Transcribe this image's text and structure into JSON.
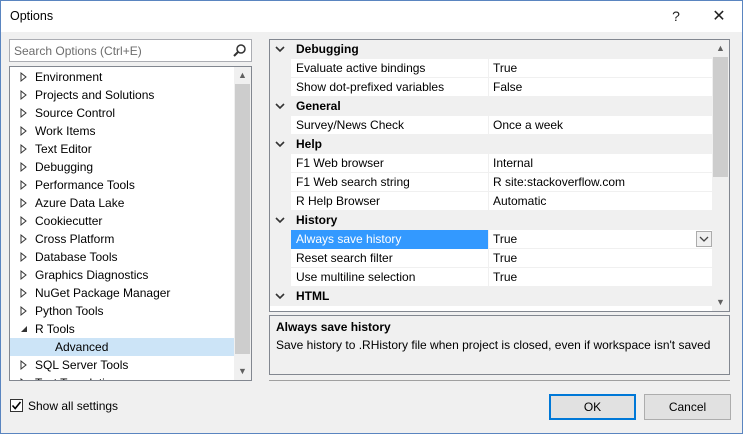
{
  "window": {
    "title": "Options",
    "help_label": "?",
    "close_label": "✕"
  },
  "search": {
    "placeholder": "Search Options (Ctrl+E)"
  },
  "tree": {
    "items": [
      {
        "label": "Environment",
        "expanded": false
      },
      {
        "label": "Projects and Solutions",
        "expanded": false
      },
      {
        "label": "Source Control",
        "expanded": false
      },
      {
        "label": "Work Items",
        "expanded": false
      },
      {
        "label": "Text Editor",
        "expanded": false
      },
      {
        "label": "Debugging",
        "expanded": false
      },
      {
        "label": "Performance Tools",
        "expanded": false
      },
      {
        "label": "Azure Data Lake",
        "expanded": false
      },
      {
        "label": "Cookiecutter",
        "expanded": false
      },
      {
        "label": "Cross Platform",
        "expanded": false
      },
      {
        "label": "Database Tools",
        "expanded": false
      },
      {
        "label": "Graphics Diagnostics",
        "expanded": false
      },
      {
        "label": "NuGet Package Manager",
        "expanded": false
      },
      {
        "label": "Python Tools",
        "expanded": false
      },
      {
        "label": "R Tools",
        "expanded": true
      },
      {
        "label": "Advanced",
        "child": true,
        "selected": true
      },
      {
        "label": "SQL Server Tools",
        "expanded": false
      },
      {
        "label": "Text Templating",
        "expanded": false
      }
    ]
  },
  "grid": {
    "categories": [
      {
        "name": "Debugging",
        "props": [
          {
            "name": "Evaluate active bindings",
            "value": "True"
          },
          {
            "name": "Show dot-prefixed variables",
            "value": "False"
          }
        ]
      },
      {
        "name": "General",
        "props": [
          {
            "name": "Survey/News Check",
            "value": "Once a week"
          }
        ]
      },
      {
        "name": "Help",
        "props": [
          {
            "name": "F1 Web browser",
            "value": "Internal"
          },
          {
            "name": "F1 Web search string",
            "value": "R site:stackoverflow.com"
          },
          {
            "name": "R Help Browser",
            "value": "Automatic"
          }
        ]
      },
      {
        "name": "History",
        "props": [
          {
            "name": "Always save history",
            "value": "True",
            "selected": true
          },
          {
            "name": "Reset search filter",
            "value": "True"
          },
          {
            "name": "Use multiline selection",
            "value": "True"
          }
        ]
      },
      {
        "name": "HTML",
        "props": []
      }
    ]
  },
  "description": {
    "title": "Always save history",
    "text": "Save history to .RHistory file when project is closed, even if workspace isn't saved"
  },
  "footer": {
    "show_all_label": "Show all settings",
    "show_all_checked": true,
    "ok_label": "OK",
    "cancel_label": "Cancel"
  },
  "colors": {
    "accent": "#0078d7",
    "selection": "#3399ff",
    "tree_selection": "#cce4f7"
  }
}
